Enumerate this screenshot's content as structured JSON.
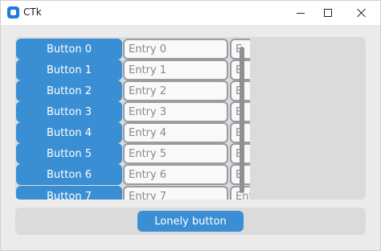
{
  "window": {
    "title": "CTk",
    "controls": {
      "minimize_icon": "minimize-icon",
      "maximize_icon": "maximize-icon",
      "close_icon": "close-icon"
    }
  },
  "rows": [
    {
      "button": "Button 0",
      "entry_placeholder": "Entry 0",
      "entry_cut": "E"
    },
    {
      "button": "Button 1",
      "entry_placeholder": "Entry 1",
      "entry_cut": "E"
    },
    {
      "button": "Button 2",
      "entry_placeholder": "Entry 2",
      "entry_cut": "E"
    },
    {
      "button": "Button 3",
      "entry_placeholder": "Entry 3",
      "entry_cut": "E"
    },
    {
      "button": "Button 4",
      "entry_placeholder": "Entry 4",
      "entry_cut": "E"
    },
    {
      "button": "Button 5",
      "entry_placeholder": "Entry 5",
      "entry_cut": "E"
    },
    {
      "button": "Button 6",
      "entry_placeholder": "Entry 6",
      "entry_cut": "E"
    },
    {
      "button": "Button 7",
      "entry_placeholder": "Entry 7",
      "entry_cut": "Ent"
    }
  ],
  "bottom": {
    "button": "Lonely button"
  },
  "colors": {
    "button": "#3a8ed3",
    "frame": "#dbdbdb",
    "window_bg": "#ebebeb",
    "entry_bg": "#f9f9fa",
    "entry_border": "#979da2",
    "app_icon": "#1f7ad9"
  }
}
